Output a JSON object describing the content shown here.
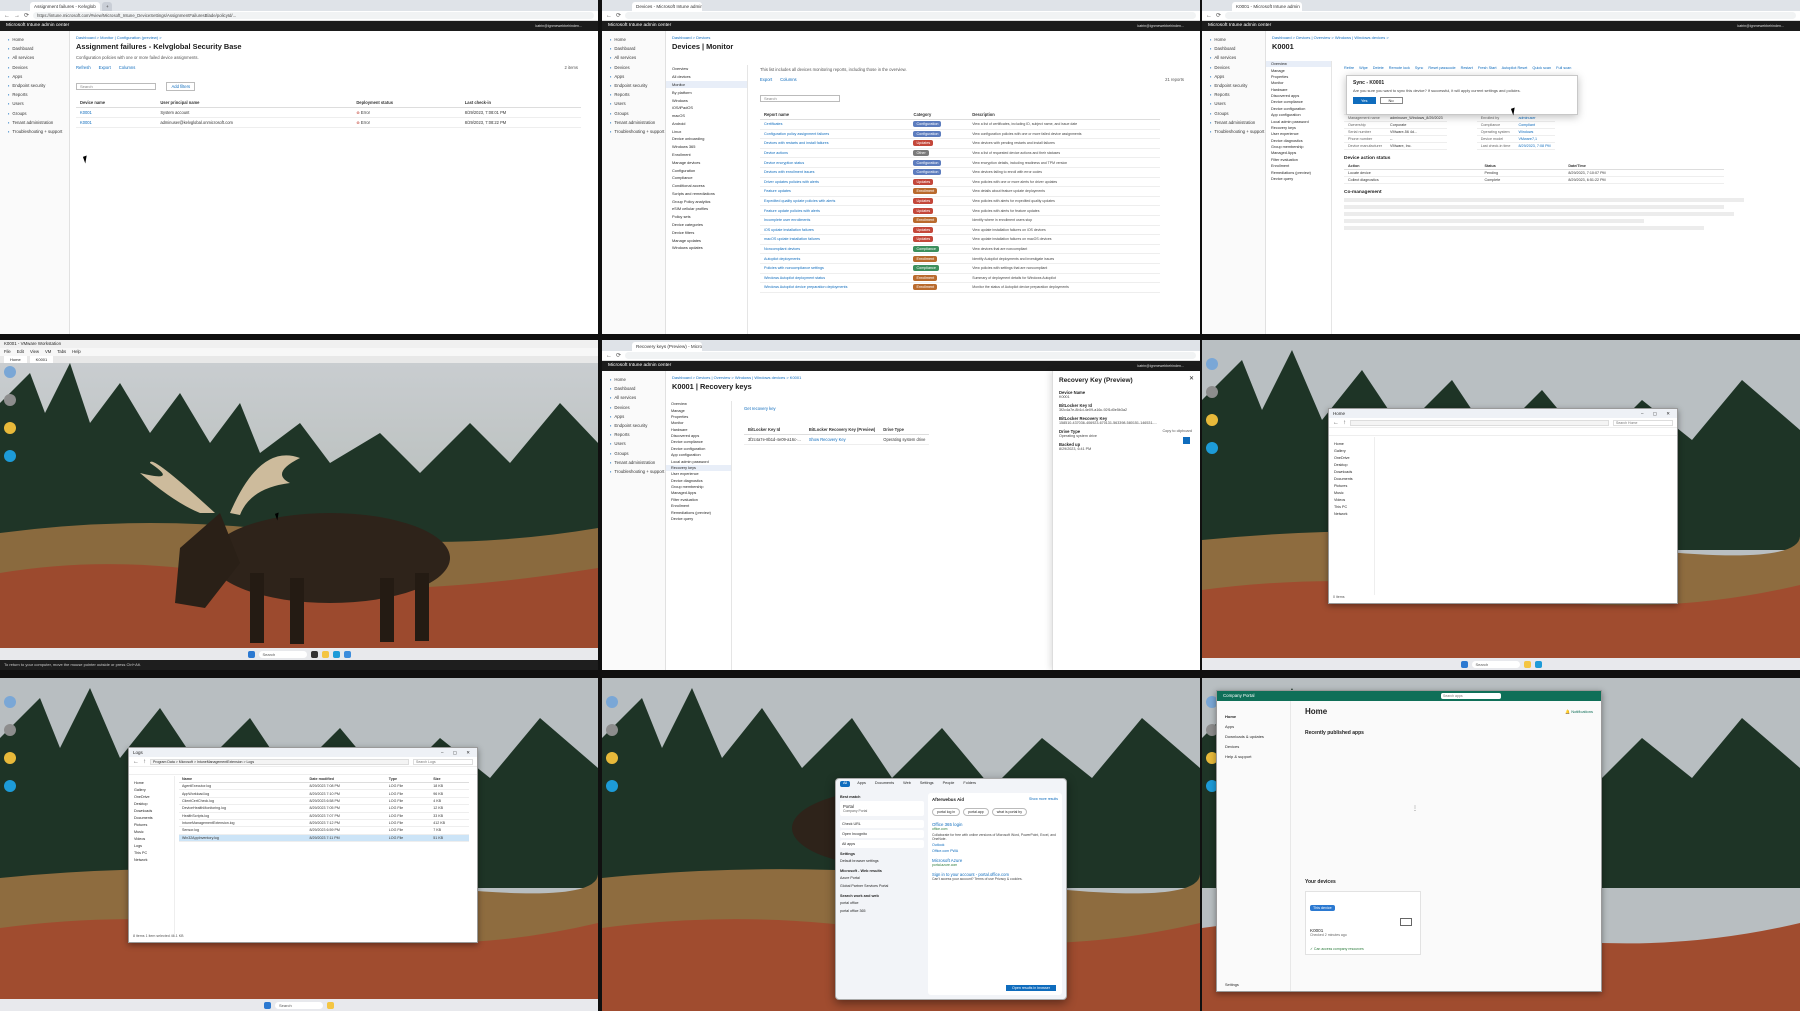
{
  "intune_header": {
    "app_title": "Microsoft Intune admin center",
    "account": "katrin@ignmewebbehinden...",
    "sidenav": [
      "Home",
      "Dashboard",
      "All services",
      "Devices",
      "Apps",
      "Endpoint security",
      "Reports",
      "Users",
      "Groups",
      "Tenant administration",
      "Troubleshooting + support"
    ]
  },
  "panel1": {
    "tab_label": "Assignment failures - Kelvglob",
    "url": "https://intune.microsoft.com/#view/Microsoft_Intune_DeviceSettings/AssignmentFailuresBlade/policyId/...",
    "breadcrumb": "Dashboard > Monitor | Configuration (preview) >",
    "title": "Assignment failures - Kelvglobal Security Base",
    "description": "Configuration policies with one or more failed device assignments.",
    "toolbar": [
      "Refresh",
      "Export",
      "Columns"
    ],
    "search_placeholder": "Search",
    "add_filters": "Add filters",
    "items_count": "2 items",
    "columns": [
      "Device name",
      "User principal name",
      "Deployment status",
      "Last check-in"
    ],
    "rows": [
      {
        "device": "K0001",
        "upn": "System account",
        "status": "Error",
        "checkin": "8/29/2023, 7:08:01 PM"
      },
      {
        "device": "K0001",
        "upn": "adminuser@kelvglobal.onmicrosoft.com",
        "status": "Error",
        "checkin": "8/29/2023, 7:08:22 PM"
      }
    ]
  },
  "panel2": {
    "tab_label": "Devices - Microsoft Intune admin",
    "breadcrumb": "Dashboard > Devices",
    "title": "Devices | Monitor",
    "subtitle": "This list includes all devices monitoring reports, including those in the overview.",
    "toolbar": [
      "Export",
      "Columns"
    ],
    "reports_count": "21 reports",
    "left_nav": [
      "Overview",
      "All devices",
      "Monitor",
      "By platform",
      "Windows",
      "iOS/iPadOS",
      "macOS",
      "Android",
      "Linux",
      "Device onboarding",
      "Windows 365",
      "Enrollment",
      "Manage devices",
      "Configuration",
      "Compliance",
      "Conditional access",
      "Scripts and remediations",
      "Group Policy analytics",
      "eSIM cellular profiles",
      "Policy sets",
      "Device categories",
      "Device filters",
      "Manage updates",
      "Windows updates"
    ],
    "columns": [
      "Report name",
      "Category",
      "Description"
    ],
    "reports": [
      {
        "name": "Certificates",
        "cat": "Configuration",
        "desc": "View a list of certificates, including ID, subject name, and issue date"
      },
      {
        "name": "Configuration policy assignment failures",
        "cat": "Configuration",
        "desc": "View configuration policies with one or more failed device assignments"
      },
      {
        "name": "Devices with restarts and install failures",
        "cat": "Updates",
        "desc": "View devices with pending restarts and install failures"
      },
      {
        "name": "Device actions",
        "cat": "Other",
        "desc": "View a list of requested device actions and their statuses"
      },
      {
        "name": "Device encryption status",
        "cat": "Configuration",
        "desc": "View encryption details, including readiness and TPM version"
      },
      {
        "name": "Devices with enrollment issues",
        "cat": "Configuration",
        "desc": "View devices failing to enroll with error codes"
      },
      {
        "name": "Driver updates policies with alerts",
        "cat": "Updates",
        "desc": "View policies with one or more alerts for driver updates"
      },
      {
        "name": "Feature updates",
        "cat": "Enrollment",
        "desc": "View details about feature update deployments"
      },
      {
        "name": "Expedited quality update policies with alerts",
        "cat": "Updates",
        "desc": "View policies with alerts for expedited quality updates"
      },
      {
        "name": "Feature update policies with alerts",
        "cat": "Updates",
        "desc": "View policies with alerts for feature updates"
      },
      {
        "name": "Incomplete user enrollments",
        "cat": "Enrollment",
        "desc": "Identify where in enrollment users stop"
      },
      {
        "name": "iOS update installation failures",
        "cat": "Updates",
        "desc": "View update installation failures on iOS devices"
      },
      {
        "name": "macOS update installation failures",
        "cat": "Updates",
        "desc": "View update installation failures on macOS devices"
      },
      {
        "name": "Noncompliant devices",
        "cat": "Compliance",
        "desc": "View devices that are noncompliant"
      },
      {
        "name": "Autopilot deployments",
        "cat": "Enrollment",
        "desc": "Identify Autopilot deployments and investigate issues"
      },
      {
        "name": "Policies with noncompliance settings",
        "cat": "Compliance",
        "desc": "View policies with settings that are noncompliant"
      },
      {
        "name": "Windows Autopilot deployment status",
        "cat": "Enrollment",
        "desc": "Summary of deployment details for Windows Autopilot"
      },
      {
        "name": "Windows Autopilot device preparation deployments",
        "cat": "Enrollment",
        "desc": "Monitor the status of Autopilot device preparation deployments"
      }
    ],
    "badge_colors": {
      "Configuration": "#5c7cbe",
      "Updates": "#c4473a",
      "Other": "#7a7a7a",
      "Enrollment": "#b96a2d",
      "Compliance": "#3c8f5d"
    }
  },
  "panel3": {
    "tab_label": "K0001 - Microsoft Intune admin",
    "breadcrumb": "Dashboard > Devices | Overview > Windows | Windows devices >",
    "title": "K0001",
    "actions": [
      "Retire",
      "Wipe",
      "Delete",
      "Remote lock",
      "Sync",
      "Reset passcode",
      "Restart",
      "Fresh Start",
      "Autopilot Reset",
      "Quick scan",
      "Full scan"
    ],
    "dialog_title": "Sync - K0001",
    "dialog_text": "Are you sure you want to sync this device? If successful, it will apply current settings and policies.",
    "dialog_yes": "Yes",
    "dialog_no": "No",
    "left_nav": [
      "Overview",
      "Manage",
      "Properties",
      "Monitor",
      "Hardware",
      "Discovered apps",
      "Device compliance",
      "Device configuration",
      "App configuration",
      "Local admin password",
      "Recovery keys",
      "User experience",
      "Device diagnostics",
      "Group membership",
      "Managed Apps",
      "Filter evaluation",
      "Enrollment",
      "Remediations (preview)",
      "Device query"
    ],
    "essentials": [
      [
        "Device name",
        "K0001"
      ],
      [
        "Management name",
        "adminuser_Windows_8/29/2023"
      ],
      [
        "Ownership",
        "Corporate"
      ],
      [
        "Serial number",
        "VMware-56 4d..."
      ],
      [
        "Phone number",
        "--"
      ],
      [
        "Device manufacturer",
        "VMware, Inc."
      ]
    ],
    "essentials_right": [
      [
        "Primary user",
        "adminuser"
      ],
      [
        "Enrolled by",
        "adminuser"
      ],
      [
        "Compliance",
        "Compliant"
      ],
      [
        "Operating system",
        "Windows"
      ],
      [
        "Device model",
        "VMware7,1"
      ],
      [
        "Last check-in time",
        "8/29/2023, 7:08 PM"
      ]
    ],
    "status_title": "Device action status",
    "status_rows": [
      [
        "Action",
        "Status",
        "Date/Time"
      ],
      [
        "Locate device",
        "Pending",
        "8/29/2023, 7:10:07 PM"
      ],
      [
        "Collect diagnostics",
        "Complete",
        "8/29/2023, 6:51:22 PM"
      ]
    ],
    "notes_title": "Co-management"
  },
  "panel4": {
    "vm_title": "K0001 - VMware Workstation",
    "vm_menus": [
      "File",
      "Edit",
      "View",
      "VM",
      "Tabs",
      "Help"
    ],
    "vm_tabs": [
      "Home",
      "K0001"
    ],
    "taskbar_search": "Search",
    "status_text": "To return to your computer, move the mouse pointer outside or press Ctrl+Alt."
  },
  "panel5": {
    "tab_label": "Recovery keys (Preview) - Micros",
    "breadcrumb": "Dashboard > Devices | Overview > Windows | Windows devices > K0001",
    "title": "K0001 | Recovery keys",
    "get_key": "Get recovery key",
    "columns": [
      "BitLocker Key Id",
      "BitLocker Recovery Key (Preview)",
      "Drive Type"
    ],
    "row": [
      "3f2c4a7e-8b1d-4e09-a16c-...",
      "Show Recovery Key",
      "Operating system drive"
    ],
    "flyout_title": "Recovery Key (Preview)",
    "flyout_fields": [
      [
        "Device Name",
        "K0001"
      ],
      [
        "BitLocker Key Id",
        "3f2c4a7e-8b1d-4e09-a16c-92f1d0e5b3a2"
      ],
      [
        "BitLocker Recovery Key",
        "158510-437036-406923-670131-563398-580151-146531-..."
      ],
      [
        "Drive Type",
        "Operating system drive"
      ],
      [
        "Backed up",
        "8/29/2023, 6:41 PM"
      ]
    ],
    "copy_label": "Copy to clipboard"
  },
  "panel6": {
    "explorer_title": "Home",
    "search_box": "Search Home",
    "nav": [
      "Home",
      "Gallery",
      "OneDrive",
      "Desktop",
      "Downloads",
      "Documents",
      "Pictures",
      "Music",
      "Videos",
      "This PC",
      "Network"
    ],
    "status": "0 items"
  },
  "panel7": {
    "explorer_title": "Logs",
    "path": "Program Data > Microsoft > IntuneManagementExtension > Logs",
    "search_box": "Search Logs",
    "columns": [
      "Name",
      "Date modified",
      "Type",
      "Size"
    ],
    "files": [
      [
        "AgentExecutor.log",
        "8/29/2023 7:08 PM",
        "LOG File",
        "18 KB"
      ],
      [
        "AppWorkload.log",
        "8/29/2023 7:10 PM",
        "LOG File",
        "96 KB"
      ],
      [
        "ClientCertCheck.log",
        "8/29/2023 6:58 PM",
        "LOG File",
        "4 KB"
      ],
      [
        "DeviceHealthMonitoring.log",
        "8/29/2023 7:05 PM",
        "LOG File",
        "12 KB"
      ],
      [
        "HealthScripts.log",
        "8/29/2023 7:07 PM",
        "LOG File",
        "33 KB"
      ],
      [
        "IntuneManagementExtension.log",
        "8/29/2023 7:12 PM",
        "LOG File",
        "412 KB"
      ],
      [
        "Sensor.log",
        "8/29/2023 6:59 PM",
        "LOG File",
        "7 KB"
      ],
      [
        "Win32AppInventory.log",
        "8/29/2023 7:11 PM",
        "LOG File",
        "51 KB"
      ]
    ],
    "nav": [
      "Home",
      "Gallery",
      "OneDrive",
      "Desktop",
      "Downloads",
      "Documents",
      "Pictures",
      "Music",
      "Videos",
      "Logs",
      "This PC",
      "Network"
    ],
    "status": "8 items   1 item selected 46.1 KB"
  },
  "panel8": {
    "tabs": [
      "All",
      "Apps",
      "Documents",
      "Web",
      "Settings",
      "People",
      "Folders"
    ],
    "best_match": "Portal",
    "best_match_sub": "Company Portal",
    "left_items": [
      "Check URL",
      "Open Incognito",
      "All apps"
    ],
    "settings_header": "Settings",
    "settings_items": [
      "Default browser settings"
    ],
    "web_header": "Microsoft - Web results",
    "web_items": [
      "Azure Portal",
      "Global Partner Services Portal"
    ],
    "more_header": "Search work and web",
    "more_items": [
      "portal office",
      "portal office 365"
    ],
    "right_title": "Afterwebus Aid",
    "right_button": "Show more results",
    "chips": [
      "portal log in",
      "portal.app",
      "what is portal by"
    ],
    "result1_title": "Office 365 login",
    "result1_url": "office.com",
    "result1_text": "Collaborate for free with online versions of Microsoft Word, PowerPoint, Excel, and OneNote.",
    "result1_links": [
      "Outlook",
      "Office.com PWA"
    ],
    "result2_title": "Microsoft Azure",
    "result2_url": "portal.azure.com",
    "result3_title": "Sign in to your account - portal.office.com",
    "result3_text": "Can't access your account? Terms of use Privacy & cookies.",
    "open_btn": "Open results in browser"
  },
  "panel9": {
    "app_title": "Company Portal",
    "search_placeholder": "Search apps",
    "notifications": "Notifications",
    "nav": [
      "Home",
      "Apps",
      "Downloads & updates",
      "Devices",
      "Help & support"
    ],
    "settings": "Settings",
    "heading": "Home",
    "recent_apps": "Recently published apps",
    "your_devices": "Your devices",
    "device_badge": "This device",
    "device_name": "K0001",
    "device_checked": "Checked 2 minutes ago",
    "device_status": "Can access company resources",
    "accent": "#0f6f58"
  }
}
